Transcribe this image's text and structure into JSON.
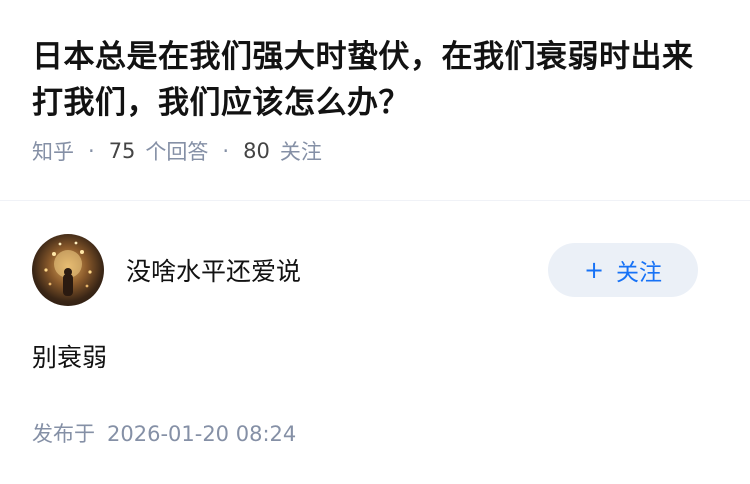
{
  "question": {
    "title": "日本总是在我们强大时蛰伏，在我们衰弱时出来打我们，我们应该怎么办？",
    "source": "知乎",
    "answer_count": "75",
    "answer_label": "个回答",
    "follower_count": "80",
    "follower_label": "关注"
  },
  "answer": {
    "author_name": "没啥水平还爱说",
    "follow_button": {
      "icon": "+",
      "label": "关注"
    },
    "content": "别衰弱",
    "publish_label": "发布于",
    "publish_time": "2026-01-20 08:24"
  },
  "colors": {
    "accent": "#1772f6",
    "meta_gray": "#8590a6",
    "button_bg": "#ebf0f7"
  }
}
